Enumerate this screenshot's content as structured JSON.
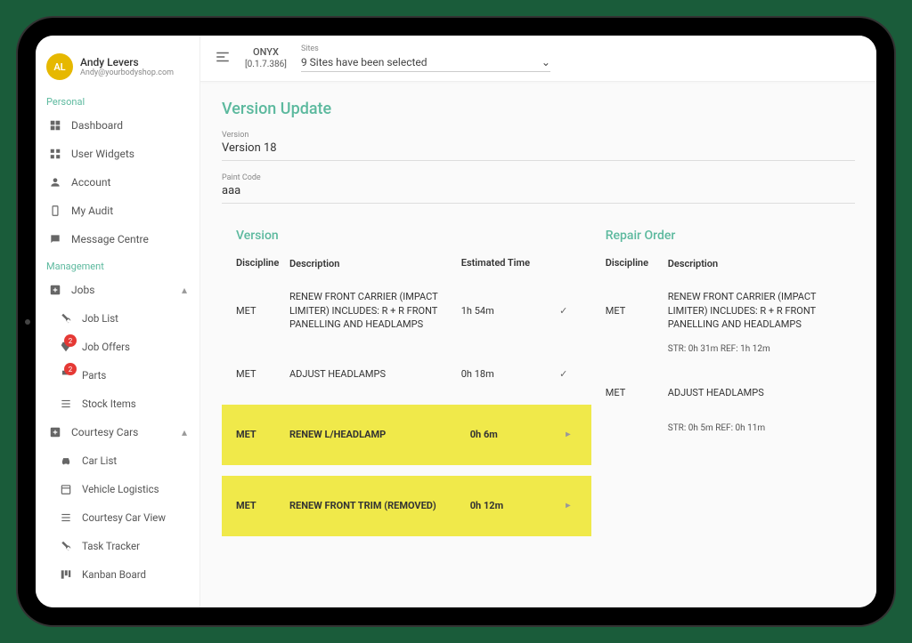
{
  "user": {
    "initials": "AL",
    "name": "Andy Levers",
    "email": "Andy@yourbodyshop.com"
  },
  "brand": {
    "name": "ONYX",
    "version": "[0.1.7.386]"
  },
  "sites": {
    "label": "Sites",
    "selected": "9 Sites have been selected"
  },
  "nav": {
    "personal_label": "Personal",
    "management_label": "Management",
    "dashboard": "Dashboard",
    "user_widgets": "User Widgets",
    "account": "Account",
    "my_audit": "My Audit",
    "message_centre": "Message Centre",
    "jobs": "Jobs",
    "job_list": "Job List",
    "job_offers": "Job Offers",
    "parts": "Parts",
    "stock_items": "Stock Items",
    "courtesy_cars": "Courtesy Cars",
    "car_list": "Car List",
    "vehicle_logistics": "Vehicle Logistics",
    "courtesy_car_view": "Courtesy Car View",
    "task_tracker": "Task Tracker",
    "kanban_board": "Kanban Board",
    "badge_job_offers": "2",
    "badge_parts": "2"
  },
  "page": {
    "title": "Version Update",
    "version_label": "Version",
    "version_value": "Version 18",
    "paint_label": "Paint Code",
    "paint_value": "aaa"
  },
  "version_table": {
    "title": "Version",
    "headers": {
      "discipline": "Discipline",
      "description": "Description",
      "time": "Estimated Time"
    },
    "rows": [
      {
        "discipline": "MET",
        "description": "RENEW FRONT CARRIER (IMPACT LIMITER) INCLUDES: R + R FRONT PANELLING AND HEADLAMPS",
        "time": "1h 54m",
        "checked": true,
        "hl": false
      },
      {
        "discipline": "MET",
        "description": "ADJUST HEADLAMPS",
        "time": "0h 18m",
        "checked": true,
        "hl": false
      },
      {
        "discipline": "MET",
        "description": "RENEW L/HEADLAMP",
        "time": "0h 6m",
        "checked": false,
        "hl": true
      },
      {
        "discipline": "MET",
        "description": "RENEW FRONT TRIM (REMOVED)",
        "time": "0h 12m",
        "checked": false,
        "hl": true
      }
    ]
  },
  "repair_table": {
    "title": "Repair Order",
    "headers": {
      "discipline": "Discipline",
      "description": "Description"
    },
    "rows": [
      {
        "discipline": "MET",
        "description": "RENEW FRONT CARRIER (IMPACT LIMITER) INCLUDES: R + R FRONT PANELLING AND HEADLAMPS",
        "sub": "STR: 0h 31m REF: 1h 12m"
      },
      {
        "discipline": "MET",
        "description": "ADJUST HEADLAMPS",
        "sub": "STR: 0h 5m REF: 0h 11m"
      }
    ]
  }
}
